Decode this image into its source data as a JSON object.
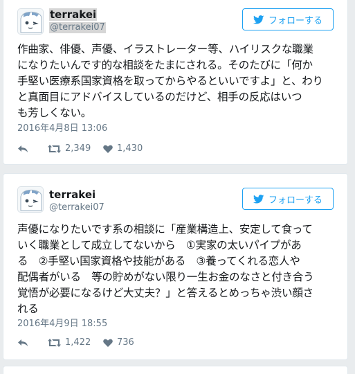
{
  "tweets": [
    {
      "name": "terrakei",
      "handle": "@terrakei07",
      "follow_label": "フォローする",
      "text_lines": [
        "作曲家、俳優、声優、イラストレーター等、ハイリスクな職業",
        "になりたいんです的な相談をたまにされる。そのたびに「何か",
        "手堅い医療系国家資格を取ってからやるといいですよ」と、わり",
        "と真面目にアドバイスしているのだけど、相手の反応はいつ",
        "も芳しくない。"
      ],
      "timestamp": "2016年4月8日 13:06",
      "retweets": "2,349",
      "likes": "1,430"
    },
    {
      "name": "terrakei",
      "handle": "@terrakei07",
      "follow_label": "フォローする",
      "text_lines": [
        "声優になりたいです系の相談に「産業構造上、安定して食って",
        "いく職業として成立してないから　①実家の太いパイプがあ",
        "る　②手堅い国家資格や技能がある　③養ってくれる恋人や",
        "配偶者がいる　等の貯めがない限り一生お金のなさと付き合う",
        "覚悟が必要になるけど大丈夫？」と答えるとめっちゃ渋い顔さ",
        "れる"
      ],
      "timestamp": "2016年4月9日 18:55",
      "retweets": "1,422",
      "likes": "736"
    }
  ],
  "colors": {
    "accent": "#1da1f2",
    "muted": "#657786",
    "text": "#14171a",
    "background": "#e9ecee"
  },
  "icons": [
    "twitter-bird-icon",
    "reply-icon",
    "retweet-icon",
    "heart-icon"
  ]
}
